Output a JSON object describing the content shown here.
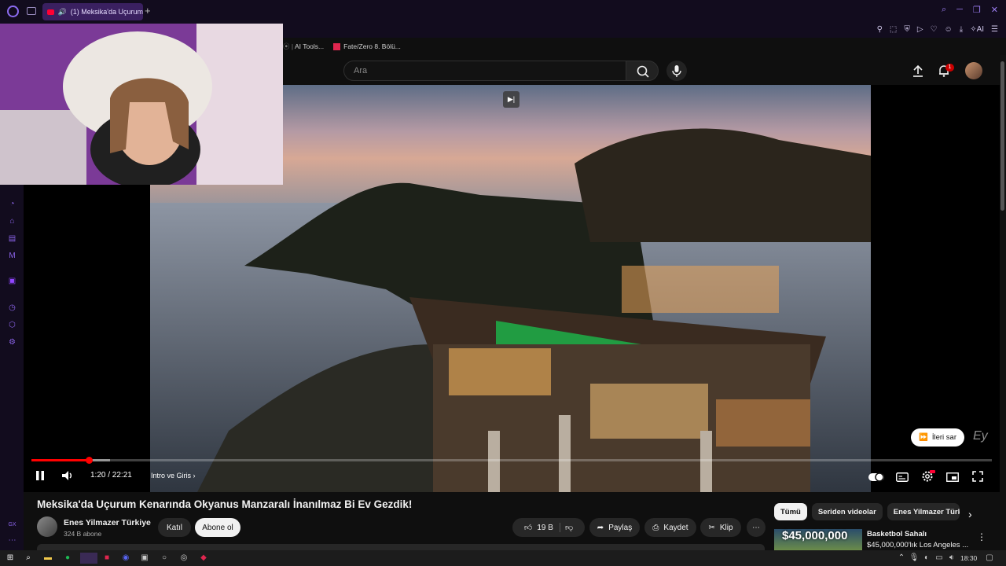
{
  "browser": {
    "active_tab_title": "(1) Meksika'da Uçurum",
    "bookmarks": [
      "AI Tools...",
      "Fate/Zero 8. Bölü..."
    ],
    "ai_label": "AI"
  },
  "header": {
    "search_placeholder": "Ara",
    "notification_count": "1"
  },
  "player": {
    "time": "1:20 / 22:21",
    "chapter": "Intro ve Giris",
    "skip_label": "İleri sar",
    "watermark": "Ey",
    "progress_fraction": 0.06
  },
  "video": {
    "title": "Meksika'da Uçurum Kenarında Okyanus Manzaralı İnanılmaz Bi Ev Gezdik!",
    "channel_name": "Enes Yilmazer Türkiye",
    "subscribers": "324 B abone",
    "join_label": "Katıl",
    "subscribe_label": "Abone ol",
    "likes": "19 B",
    "share_label": "Paylaş",
    "save_label": "Kaydet",
    "clip_label": "Klip"
  },
  "recommendations": {
    "chips": [
      "Tümü",
      "Seriden videolar",
      "Enes Yilmazer Türkiye"
    ],
    "first": {
      "thumb_text": "$45,000,000",
      "title": "Basketbol Sahalı",
      "subtitle": "$45,000,000'lık Los Angeles ..."
    }
  },
  "taskbar": {
    "clock": "18:30"
  }
}
